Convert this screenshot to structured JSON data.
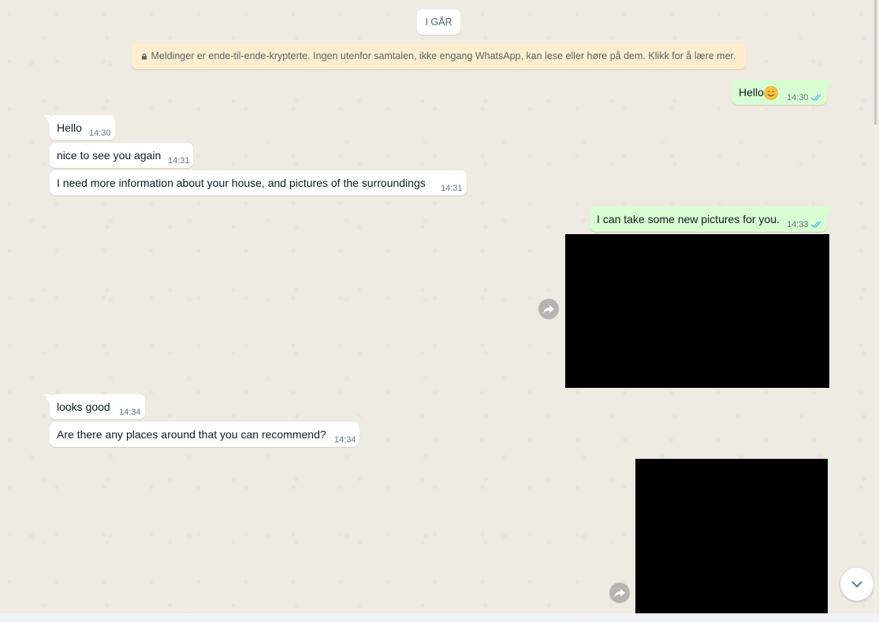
{
  "date_chip": "I GÅR",
  "encryption_notice": "Meldinger er ende-til-ende-krypterte. Ingen utenfor samtalen, ikke engang WhatsApp, kan lese eller høre på dem. Klikk for å lære mer.",
  "messages": [
    {
      "direction": "out",
      "text": "Hello",
      "emoji": "smiling-face-emoji",
      "time": "14:30",
      "status": "read"
    },
    {
      "direction": "in",
      "text": "Hello",
      "time": "14:30"
    },
    {
      "direction": "in",
      "text": "nice to see you again",
      "time": "14:31"
    },
    {
      "direction": "in",
      "text": "I need more information about your house, and pictures of the surroundings",
      "time": "14:31"
    },
    {
      "direction": "out",
      "text": "I can take some new pictures for you.",
      "time": "14:33",
      "status": "read"
    },
    {
      "direction": "out",
      "type": "image",
      "content": "redacted-black-image"
    },
    {
      "direction": "in",
      "text": "looks good",
      "time": "14:34"
    },
    {
      "direction": "in",
      "text": "Are there any places around that you can recommend?",
      "time": "14:34"
    },
    {
      "direction": "out",
      "type": "image",
      "content": "redacted-black-image"
    }
  ],
  "colors": {
    "chat_background": "#efeae2",
    "incoming_bubble": "#ffffff",
    "outgoing_bubble": "#d9fdd3",
    "read_ticks": "#53bdeb",
    "encryption_banner": "#ffeecd"
  },
  "icons": {
    "lock": "lock-icon",
    "forward": "forward-icon",
    "scroll_down": "chevron-down-icon",
    "read_receipt": "double-check-icon"
  }
}
